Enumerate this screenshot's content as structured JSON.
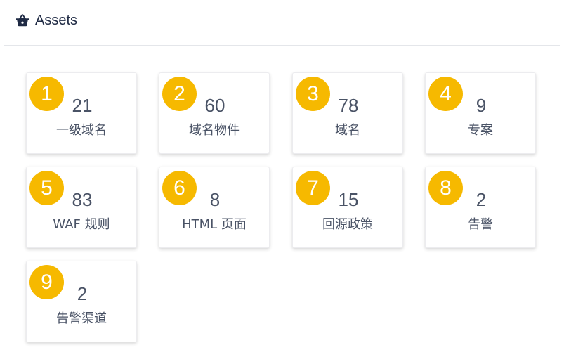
{
  "header": {
    "title": "Assets",
    "icon": "basket-icon"
  },
  "colors": {
    "badge": "#f6b900",
    "text": "#4a5366",
    "title": "#1f2a44"
  },
  "cards": [
    {
      "index": "1",
      "value": "21",
      "label": "一级域名"
    },
    {
      "index": "2",
      "value": "60",
      "label": "域名物件"
    },
    {
      "index": "3",
      "value": "78",
      "label": "域名"
    },
    {
      "index": "4",
      "value": "9",
      "label": "专案"
    },
    {
      "index": "5",
      "value": "83",
      "label": "WAF 规则"
    },
    {
      "index": "6",
      "value": "8",
      "label": "HTML 页面"
    },
    {
      "index": "7",
      "value": "15",
      "label": "回源政策"
    },
    {
      "index": "8",
      "value": "2",
      "label": "告警"
    },
    {
      "index": "9",
      "value": "2",
      "label": "告警渠道"
    }
  ]
}
